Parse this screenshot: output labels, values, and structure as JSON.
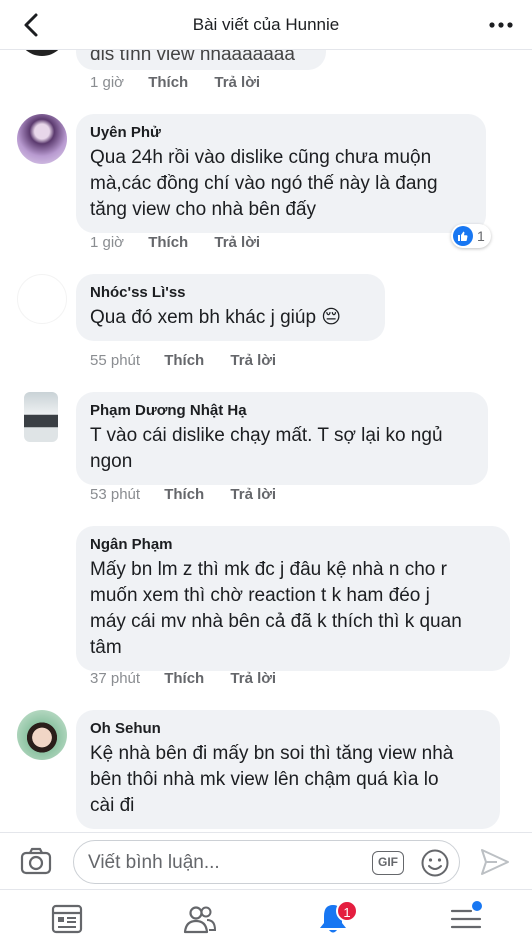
{
  "header": {
    "title": "Bài viết của Hunnie",
    "back_icon": "chevron-left-icon",
    "more_icon": "more-horizontal-icon"
  },
  "comments": [
    {
      "author": "",
      "text": "dis tính view nhaaaaaaa",
      "time": "1 giờ",
      "like_label": "Thích",
      "reply_label": "Trả lời"
    },
    {
      "author": "Uyên Phử",
      "text": [
        "Qua 24h rồi vào dislike cũng chưa muộn",
        "mà,các đồng chí vào ngó thế này là đang",
        "tăng view cho nhà bên đấy"
      ],
      "time": "1 giờ",
      "like_label": "Thích",
      "reply_label": "Trả lời",
      "reaction_count": "1"
    },
    {
      "author": "Nhóc'ss Lì'ss",
      "text": [
        "Qua đó xem bh khác j giúp 😔"
      ],
      "time": "55 phút",
      "like_label": "Thích",
      "reply_label": "Trả lời"
    },
    {
      "author": "Phạm Dương Nhật Hạ",
      "text": [
        "T vào cái dislike chạy mất. T sợ lại ko ngủ",
        "ngon"
      ],
      "time": "53 phút",
      "like_label": "Thích",
      "reply_label": "Trả lời"
    },
    {
      "author": "Ngân Phạm",
      "text": [
        "Mấy bn lm z thì mk đc j đâu kệ nhà n cho r",
        "muốn xem thì chờ reaction t k ham đéo j",
        "máy cái mv nhà bên cả đã k thích thì k quan",
        "tâm"
      ],
      "time": "37 phút",
      "like_label": "Thích",
      "reply_label": "Trả lời"
    },
    {
      "author": "Oh Sehun",
      "text": [
        "Kệ nhà bên đi mấy bn soi thì tăng view nhà",
        "bên thôi nhà mk view lên chậm quá kìa lo",
        "cài đi"
      ]
    }
  ],
  "composer": {
    "placeholder": "Viết bình luận...",
    "gif_label": "GIF",
    "camera_icon": "camera-icon",
    "emoji_icon": "emoji-icon",
    "send_icon": "send-icon"
  },
  "tabbar": {
    "items": [
      "news-feed-icon",
      "friends-icon",
      "notifications-icon",
      "menu-icon"
    ],
    "notification_badge": "1"
  },
  "colors": {
    "accent": "#1877f2",
    "bubble": "#f0f2f5",
    "badge": "#e41e3f"
  }
}
